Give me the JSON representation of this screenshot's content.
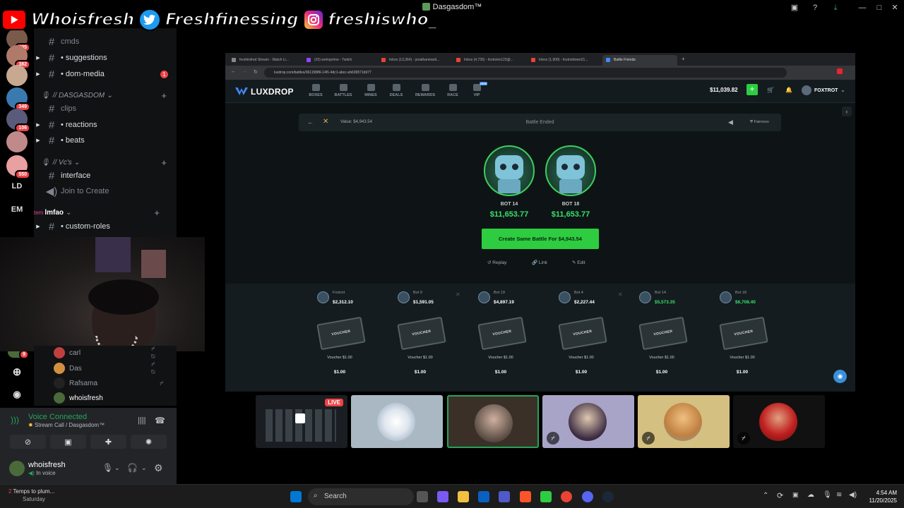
{
  "window": {
    "title": "Dasgasdom™"
  },
  "socials": {
    "youtube": "Whoisfresh",
    "twitter": "Freshfinessing",
    "instagram": "freshiswho_"
  },
  "servers": [
    {
      "badge": "495"
    },
    {
      "badge": "382"
    },
    {
      "badge": ""
    },
    {
      "badge": "349"
    },
    {
      "badge": "106"
    },
    {
      "badge": ""
    },
    {
      "badge": "550"
    },
    {
      "badge": "9"
    }
  ],
  "server_labels": {
    "ld": "LD",
    "em": "EM"
  },
  "channels": {
    "cmds": "cmds",
    "suggestions": "suggestions",
    "dom_media": "dom-media",
    "dom_media_unread": "1",
    "category_dasgasdom": "// DASGASDOM",
    "clips": "clips",
    "reactions": "reactions",
    "beats": "beats",
    "category_vcs": "// Vc's",
    "interface": "interface",
    "join_to_create": "Join to Create",
    "category_lmfao": "lmfao",
    "custom_roles": "custom-roles",
    "overlay_name": "tem"
  },
  "voice_members": [
    {
      "name": "carl"
    },
    {
      "name": "Das"
    },
    {
      "name": "Rafsama"
    },
    {
      "name": "whoisfresh"
    }
  ],
  "voice_panel": {
    "status": "Voice Connected",
    "channel": "Stream Call / Dasgasdom™",
    "username": "whoisfresh",
    "user_status": "In voice"
  },
  "browser": {
    "tabs": [
      "freshiisfred Stream - Watch Li...",
      "(20) wehoprime - Twitch",
      "Inbox (13,364) - jonathanmarti...",
      "Inbox (4,735) - foxtrotre123@...",
      "Inbox (1,909) - foxtrotdown21...",
      "Battle Friends"
    ],
    "url": "luxdrop.com/battles/36115886-14f1-4dc1-abcc-eb639571b977"
  },
  "luxdrop": {
    "logo": "LUXDROP",
    "nav": [
      "BOXES",
      "BATTLES",
      "MINES",
      "DEALS",
      "REWARDS",
      "RACE",
      "VIP"
    ],
    "new_badge": "NEW",
    "balance": "$11,039.82",
    "user": "FOXTROT",
    "battle_value": "Value: $4,943.54",
    "battle_status": "Battle Ended",
    "fairness": "Fairness",
    "winners": [
      {
        "name": "BOT 14",
        "amount": "$11,653.77"
      },
      {
        "name": "BOT 18",
        "amount": "$11,653.77"
      }
    ],
    "create_button": "Create Same Battle For $4,943.54",
    "actions": {
      "replay": "Replay",
      "link": "Link",
      "edit": "Edit"
    },
    "players": [
      {
        "name": "Foxtrot",
        "value": "$2,312.10",
        "win": false
      },
      {
        "name": "Bot 9",
        "value": "$1,591.05",
        "win": false
      },
      {
        "name": "Bot 19",
        "value": "$4,897.19",
        "win": false
      },
      {
        "name": "Bot 4",
        "value": "$2,227.44",
        "win": false
      },
      {
        "name": "Bot 14",
        "value": "$5,573.35",
        "win": true
      },
      {
        "name": "Bot 18",
        "value": "$6,708.40",
        "win": true
      }
    ],
    "voucher_label": "VOUCHER",
    "item_name": "Voucher $1.00",
    "item_price": "$1.00"
  },
  "stream_tiles": {
    "live": "LIVE"
  },
  "taskbar": {
    "notification": "Temps to plum...",
    "notification_sub": "Saturday",
    "notification_count": "2",
    "search": "Search",
    "time": "4:54 AM",
    "date": "11/20/2025"
  },
  "colors": {
    "accent_green": "#2ecc40",
    "discord_green": "#23a55a",
    "win_green": "#37e06b",
    "unread_red": "#ed4245"
  }
}
